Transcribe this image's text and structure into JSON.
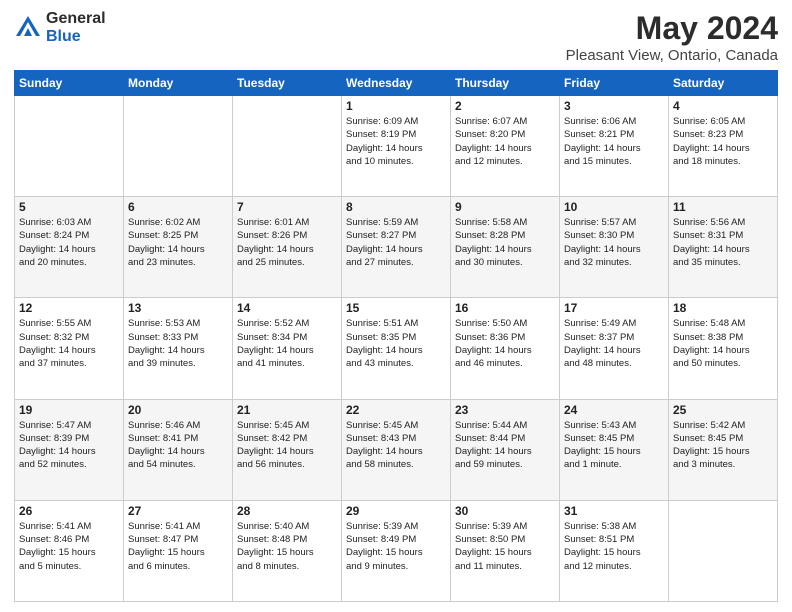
{
  "header": {
    "logo_general": "General",
    "logo_blue": "Blue",
    "title": "May 2024",
    "subtitle": "Pleasant View, Ontario, Canada"
  },
  "days_of_week": [
    "Sunday",
    "Monday",
    "Tuesday",
    "Wednesday",
    "Thursday",
    "Friday",
    "Saturday"
  ],
  "weeks": [
    [
      {
        "day": "",
        "info": ""
      },
      {
        "day": "",
        "info": ""
      },
      {
        "day": "",
        "info": ""
      },
      {
        "day": "1",
        "info": "Sunrise: 6:09 AM\nSunset: 8:19 PM\nDaylight: 14 hours\nand 10 minutes."
      },
      {
        "day": "2",
        "info": "Sunrise: 6:07 AM\nSunset: 8:20 PM\nDaylight: 14 hours\nand 12 minutes."
      },
      {
        "day": "3",
        "info": "Sunrise: 6:06 AM\nSunset: 8:21 PM\nDaylight: 14 hours\nand 15 minutes."
      },
      {
        "day": "4",
        "info": "Sunrise: 6:05 AM\nSunset: 8:23 PM\nDaylight: 14 hours\nand 18 minutes."
      }
    ],
    [
      {
        "day": "5",
        "info": "Sunrise: 6:03 AM\nSunset: 8:24 PM\nDaylight: 14 hours\nand 20 minutes."
      },
      {
        "day": "6",
        "info": "Sunrise: 6:02 AM\nSunset: 8:25 PM\nDaylight: 14 hours\nand 23 minutes."
      },
      {
        "day": "7",
        "info": "Sunrise: 6:01 AM\nSunset: 8:26 PM\nDaylight: 14 hours\nand 25 minutes."
      },
      {
        "day": "8",
        "info": "Sunrise: 5:59 AM\nSunset: 8:27 PM\nDaylight: 14 hours\nand 27 minutes."
      },
      {
        "day": "9",
        "info": "Sunrise: 5:58 AM\nSunset: 8:28 PM\nDaylight: 14 hours\nand 30 minutes."
      },
      {
        "day": "10",
        "info": "Sunrise: 5:57 AM\nSunset: 8:30 PM\nDaylight: 14 hours\nand 32 minutes."
      },
      {
        "day": "11",
        "info": "Sunrise: 5:56 AM\nSunset: 8:31 PM\nDaylight: 14 hours\nand 35 minutes."
      }
    ],
    [
      {
        "day": "12",
        "info": "Sunrise: 5:55 AM\nSunset: 8:32 PM\nDaylight: 14 hours\nand 37 minutes."
      },
      {
        "day": "13",
        "info": "Sunrise: 5:53 AM\nSunset: 8:33 PM\nDaylight: 14 hours\nand 39 minutes."
      },
      {
        "day": "14",
        "info": "Sunrise: 5:52 AM\nSunset: 8:34 PM\nDaylight: 14 hours\nand 41 minutes."
      },
      {
        "day": "15",
        "info": "Sunrise: 5:51 AM\nSunset: 8:35 PM\nDaylight: 14 hours\nand 43 minutes."
      },
      {
        "day": "16",
        "info": "Sunrise: 5:50 AM\nSunset: 8:36 PM\nDaylight: 14 hours\nand 46 minutes."
      },
      {
        "day": "17",
        "info": "Sunrise: 5:49 AM\nSunset: 8:37 PM\nDaylight: 14 hours\nand 48 minutes."
      },
      {
        "day": "18",
        "info": "Sunrise: 5:48 AM\nSunset: 8:38 PM\nDaylight: 14 hours\nand 50 minutes."
      }
    ],
    [
      {
        "day": "19",
        "info": "Sunrise: 5:47 AM\nSunset: 8:39 PM\nDaylight: 14 hours\nand 52 minutes."
      },
      {
        "day": "20",
        "info": "Sunrise: 5:46 AM\nSunset: 8:41 PM\nDaylight: 14 hours\nand 54 minutes."
      },
      {
        "day": "21",
        "info": "Sunrise: 5:45 AM\nSunset: 8:42 PM\nDaylight: 14 hours\nand 56 minutes."
      },
      {
        "day": "22",
        "info": "Sunrise: 5:45 AM\nSunset: 8:43 PM\nDaylight: 14 hours\nand 58 minutes."
      },
      {
        "day": "23",
        "info": "Sunrise: 5:44 AM\nSunset: 8:44 PM\nDaylight: 14 hours\nand 59 minutes."
      },
      {
        "day": "24",
        "info": "Sunrise: 5:43 AM\nSunset: 8:45 PM\nDaylight: 15 hours\nand 1 minute."
      },
      {
        "day": "25",
        "info": "Sunrise: 5:42 AM\nSunset: 8:45 PM\nDaylight: 15 hours\nand 3 minutes."
      }
    ],
    [
      {
        "day": "26",
        "info": "Sunrise: 5:41 AM\nSunset: 8:46 PM\nDaylight: 15 hours\nand 5 minutes."
      },
      {
        "day": "27",
        "info": "Sunrise: 5:41 AM\nSunset: 8:47 PM\nDaylight: 15 hours\nand 6 minutes."
      },
      {
        "day": "28",
        "info": "Sunrise: 5:40 AM\nSunset: 8:48 PM\nDaylight: 15 hours\nand 8 minutes."
      },
      {
        "day": "29",
        "info": "Sunrise: 5:39 AM\nSunset: 8:49 PM\nDaylight: 15 hours\nand 9 minutes."
      },
      {
        "day": "30",
        "info": "Sunrise: 5:39 AM\nSunset: 8:50 PM\nDaylight: 15 hours\nand 11 minutes."
      },
      {
        "day": "31",
        "info": "Sunrise: 5:38 AM\nSunset: 8:51 PM\nDaylight: 15 hours\nand 12 minutes."
      },
      {
        "day": "",
        "info": ""
      }
    ]
  ]
}
